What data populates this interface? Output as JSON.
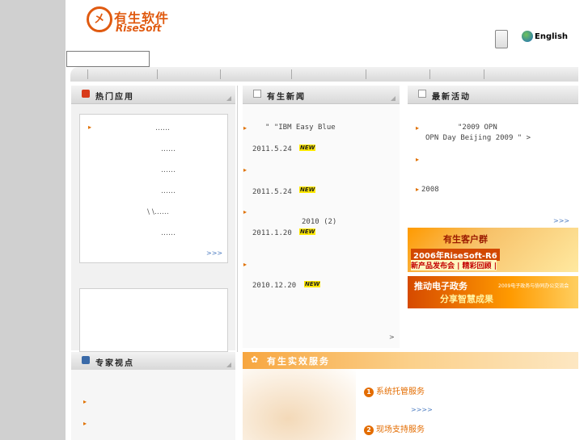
{
  "header": {
    "logo_glyph": "㐅",
    "logo_cn": "有生软件",
    "logo_en": "RiseSoft",
    "language": "English"
  },
  "hot_apps": {
    "title": "热门应用",
    "items": [
      "……",
      "……",
      "……",
      "……",
      "\\ \\……",
      "……"
    ],
    "more": ">>>"
  },
  "news": {
    "title": "有生新闻",
    "items": [
      {
        "text": "\"  \"IBM Easy Blue",
        "date": "2011.5.24",
        "badge": "NEW"
      },
      {
        "text": "",
        "date": "2011.5.24",
        "badge": "NEW"
      },
      {
        "text": "2010 (2)",
        "date": "2011.1.20",
        "badge": "NEW"
      },
      {
        "text": "",
        "date": "2010.12.20",
        "badge": "NEW"
      }
    ],
    "more": ">"
  },
  "activities": {
    "title": "最新活动",
    "item1_line1": "\"2009   OPN",
    "item1_line2": "OPN Day Beijing 2009 \"  >",
    "item3": "2008",
    "more": ">>>"
  },
  "banners": {
    "b1_title": "有生客户群",
    "b1_line2": "2006年RiseSoft-R6",
    "b1_line3": "新产品发布会 | 精彩回顾 |",
    "b2_line1": "推动电子政务",
    "b2_line2": "分享智慧成果",
    "b2_small": "2009电子政务与协同办公交流会"
  },
  "experts": {
    "title": "专家视点"
  },
  "services": {
    "title": "有生实效服务",
    "item1": "系统托管服务",
    "item1_more": ">>>>",
    "item2": "现场支持服务",
    "num1": "1",
    "num2": "2"
  }
}
